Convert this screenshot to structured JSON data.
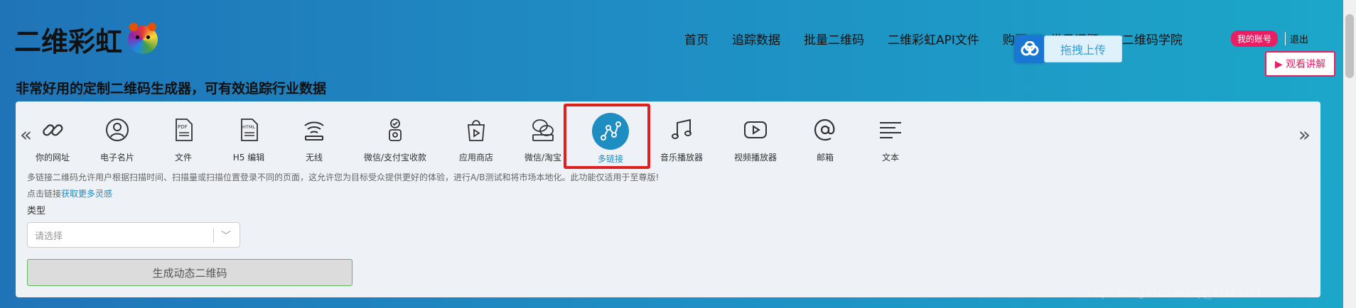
{
  "brand": {
    "name": "二维彩虹",
    "tagline": "非常好用的定制二维码生成器，可有效追踪行业数据"
  },
  "nav": {
    "items": [
      "首页",
      "追踪数据",
      "批量二维码",
      "二维彩虹API文件",
      "购买",
      "常见问题",
      "二维码学院"
    ],
    "account": "我的账号",
    "logout": "退出"
  },
  "upload": {
    "label": "拖拽上传"
  },
  "video_button": "观看讲解",
  "qr_types": [
    {
      "label": "你的网址",
      "icon": "link-icon"
    },
    {
      "label": "电子名片",
      "icon": "person-icon"
    },
    {
      "label": "文件",
      "icon": "pdf-icon"
    },
    {
      "label": "H5 编辑",
      "icon": "html-icon"
    },
    {
      "label": "无线",
      "icon": "wifi-icon"
    },
    {
      "label": "微信/支付宝收款",
      "icon": "payment-icon"
    },
    {
      "label": "应用商店",
      "icon": "app-store-icon"
    },
    {
      "label": "微信/淘宝",
      "icon": "wechat-icon"
    },
    {
      "label": "多链接",
      "icon": "multilink-icon"
    },
    {
      "label": "音乐播放器",
      "icon": "music-icon"
    },
    {
      "label": "视频播放器",
      "icon": "video-icon"
    },
    {
      "label": "邮箱",
      "icon": "email-icon"
    },
    {
      "label": "文本",
      "icon": "text-icon"
    }
  ],
  "active_type": "多链接",
  "description": "多链接二维码允许用户根据扫描时间、扫描量或扫描位置登录不同的页面，这允许您为目标受众提供更好的体验，进行A/B测试和将市场本地化。此功能仅适用于至尊版!",
  "hint": {
    "prefix": "点击链接",
    "link": "获取更多灵感"
  },
  "form": {
    "type_label": "类型",
    "select_placeholder": "请选择",
    "generate_button": "生成动态二维码"
  },
  "watermark": "https://blog.csdn.net/qq_41111111",
  "colors": {
    "accent": "#1e8dc2",
    "highlight": "#e02020",
    "badge": "#e91e63"
  }
}
